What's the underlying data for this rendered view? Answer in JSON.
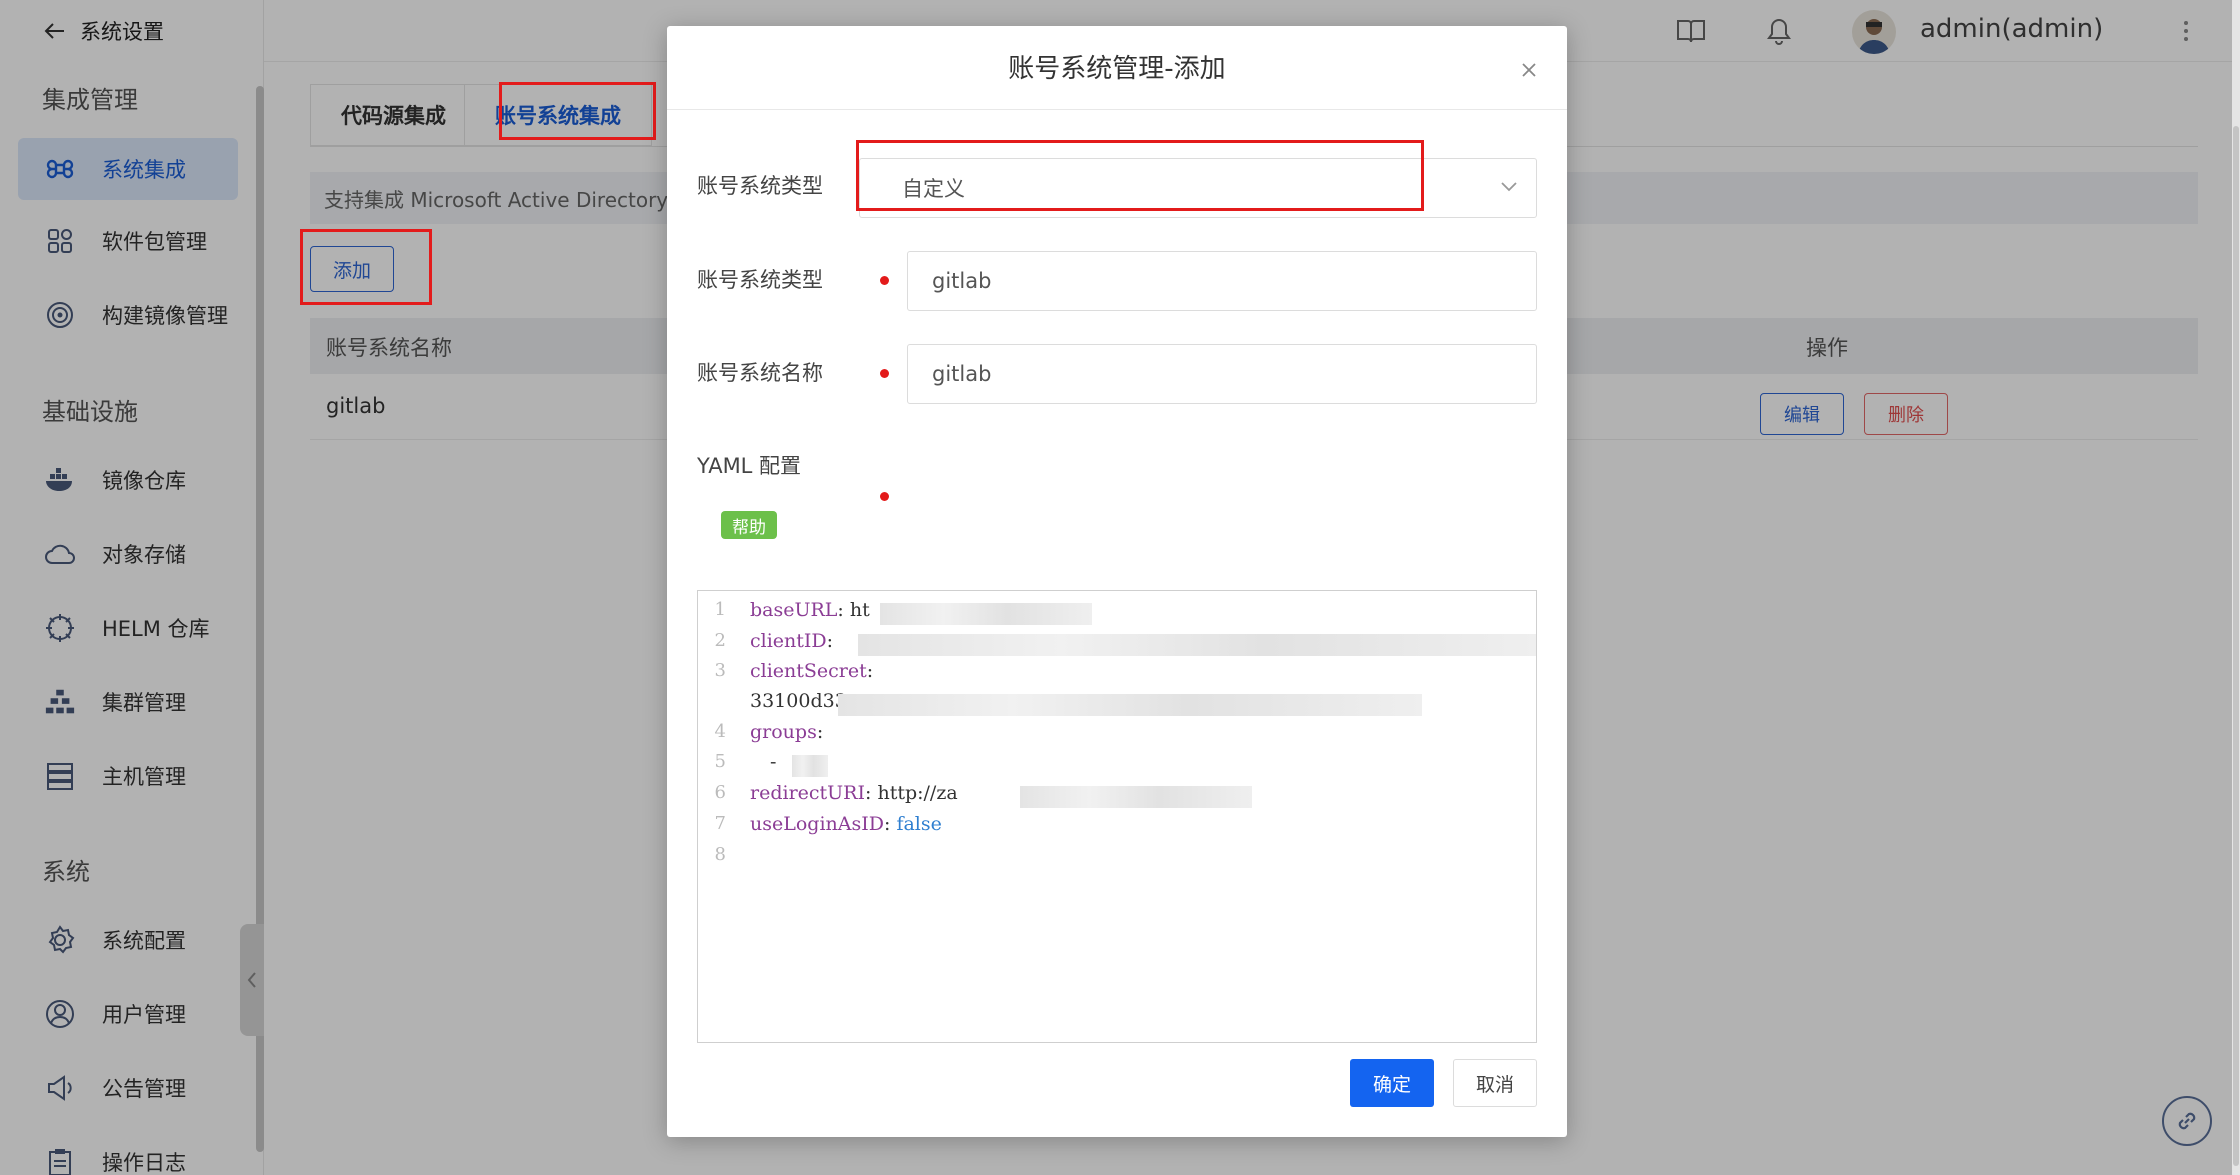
{
  "sidebar": {
    "back_label": "系统设置",
    "groups": [
      "集成管理",
      "基础设施",
      "系统"
    ],
    "items": [
      {
        "label": "系统集成",
        "icon": "command-icon"
      },
      {
        "label": "软件包管理",
        "icon": "grid-icon"
      },
      {
        "label": "构建镜像管理",
        "icon": "target-icon"
      },
      {
        "label": "镜像仓库",
        "icon": "docker-icon"
      },
      {
        "label": "对象存储",
        "icon": "cloud-icon"
      },
      {
        "label": "HELM 仓库",
        "icon": "helm-icon"
      },
      {
        "label": "集群管理",
        "icon": "cluster-icon"
      },
      {
        "label": "主机管理",
        "icon": "server-icon"
      },
      {
        "label": "系统配置",
        "icon": "settings-icon"
      },
      {
        "label": "用户管理",
        "icon": "user-icon"
      },
      {
        "label": "公告管理",
        "icon": "megaphone-icon"
      },
      {
        "label": "操作日志",
        "icon": "clipboard-icon"
      }
    ]
  },
  "topbar": {
    "user": "admin(admin)"
  },
  "content": {
    "tabs": [
      "代码源集成",
      "账号系统集成"
    ],
    "notice": "支持集成 Microsoft Active Directory、",
    "add_label": "添加",
    "table": {
      "headers": [
        "账号系统名称",
        "操作"
      ],
      "rows": [
        {
          "name": "gitlab",
          "edit": "编辑",
          "delete": "删除"
        }
      ]
    }
  },
  "modal": {
    "title": "账号系统管理-添加",
    "fields": {
      "type_select_label": "账号系统类型",
      "type_select_value": "自定义",
      "type_label": "账号系统类型",
      "type_value": "gitlab",
      "name_label": "账号系统名称",
      "name_value": "gitlab",
      "yaml_label": "YAML 配置"
    },
    "help_label": "帮助",
    "code": {
      "line_numbers": [
        "1",
        "2",
        "3",
        "4",
        "5",
        "6",
        "7",
        "8"
      ],
      "baseURL_key": "baseURL",
      "baseURL_val": "ht",
      "clientID_key": "clientID",
      "clientSecret_key": "clientSecret",
      "clientSecret_val": "33100d33",
      "groups_key": "groups",
      "dash": "-",
      "redirectURI_key": "redirectURI",
      "redirectURI_val": "http://za",
      "useLoginAsID_key": "useLoginAsID",
      "useLoginAsID_val": "false"
    },
    "ok_label": "确定",
    "cancel_label": "取消"
  },
  "colors": {
    "primary": "#1464f0",
    "accent_blue": "#2e66d4",
    "danger": "#e35050",
    "help_green": "#6cc04a",
    "annotation_red": "#e31b1b"
  }
}
